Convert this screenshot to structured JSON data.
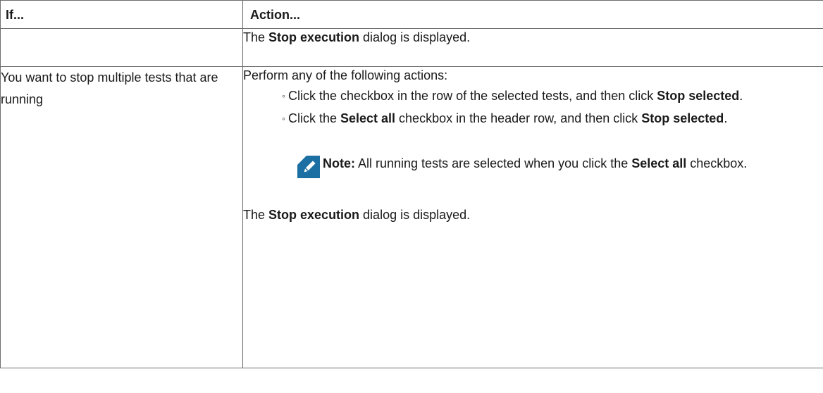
{
  "table": {
    "header": {
      "col1": "If...",
      "col2": "Action..."
    },
    "row1": {
      "result_prefix": "The ",
      "result_bold": "Stop execution",
      "result_suffix": " dialog is displayed."
    },
    "row2": {
      "condition": "You want to stop multiple tests that are running",
      "intro": "Perform any of the following actions:",
      "bullet1": {
        "mark": "◦",
        "text1": "Click the checkbox in the row of the selected tests, and then click ",
        "bold1": "Stop selected",
        "text2": "."
      },
      "bullet2": {
        "mark": "◦",
        "text1": "Click the ",
        "bold1": "Select all",
        "text2": " checkbox in the header row, and then click ",
        "bold2": "Stop selected",
        "text3": "."
      },
      "note": {
        "icon": "pencil-note-icon",
        "label": "Note:",
        "text1": " All running tests are selected when you click the ",
        "bold1": "Select all",
        "text2": " checkbox."
      },
      "result_prefix": "The ",
      "result_bold": "Stop execution",
      "result_suffix": " dialog is displayed."
    }
  },
  "colors": {
    "border": "#6d6d6d",
    "note_icon_bg": "#1c6fa3"
  }
}
